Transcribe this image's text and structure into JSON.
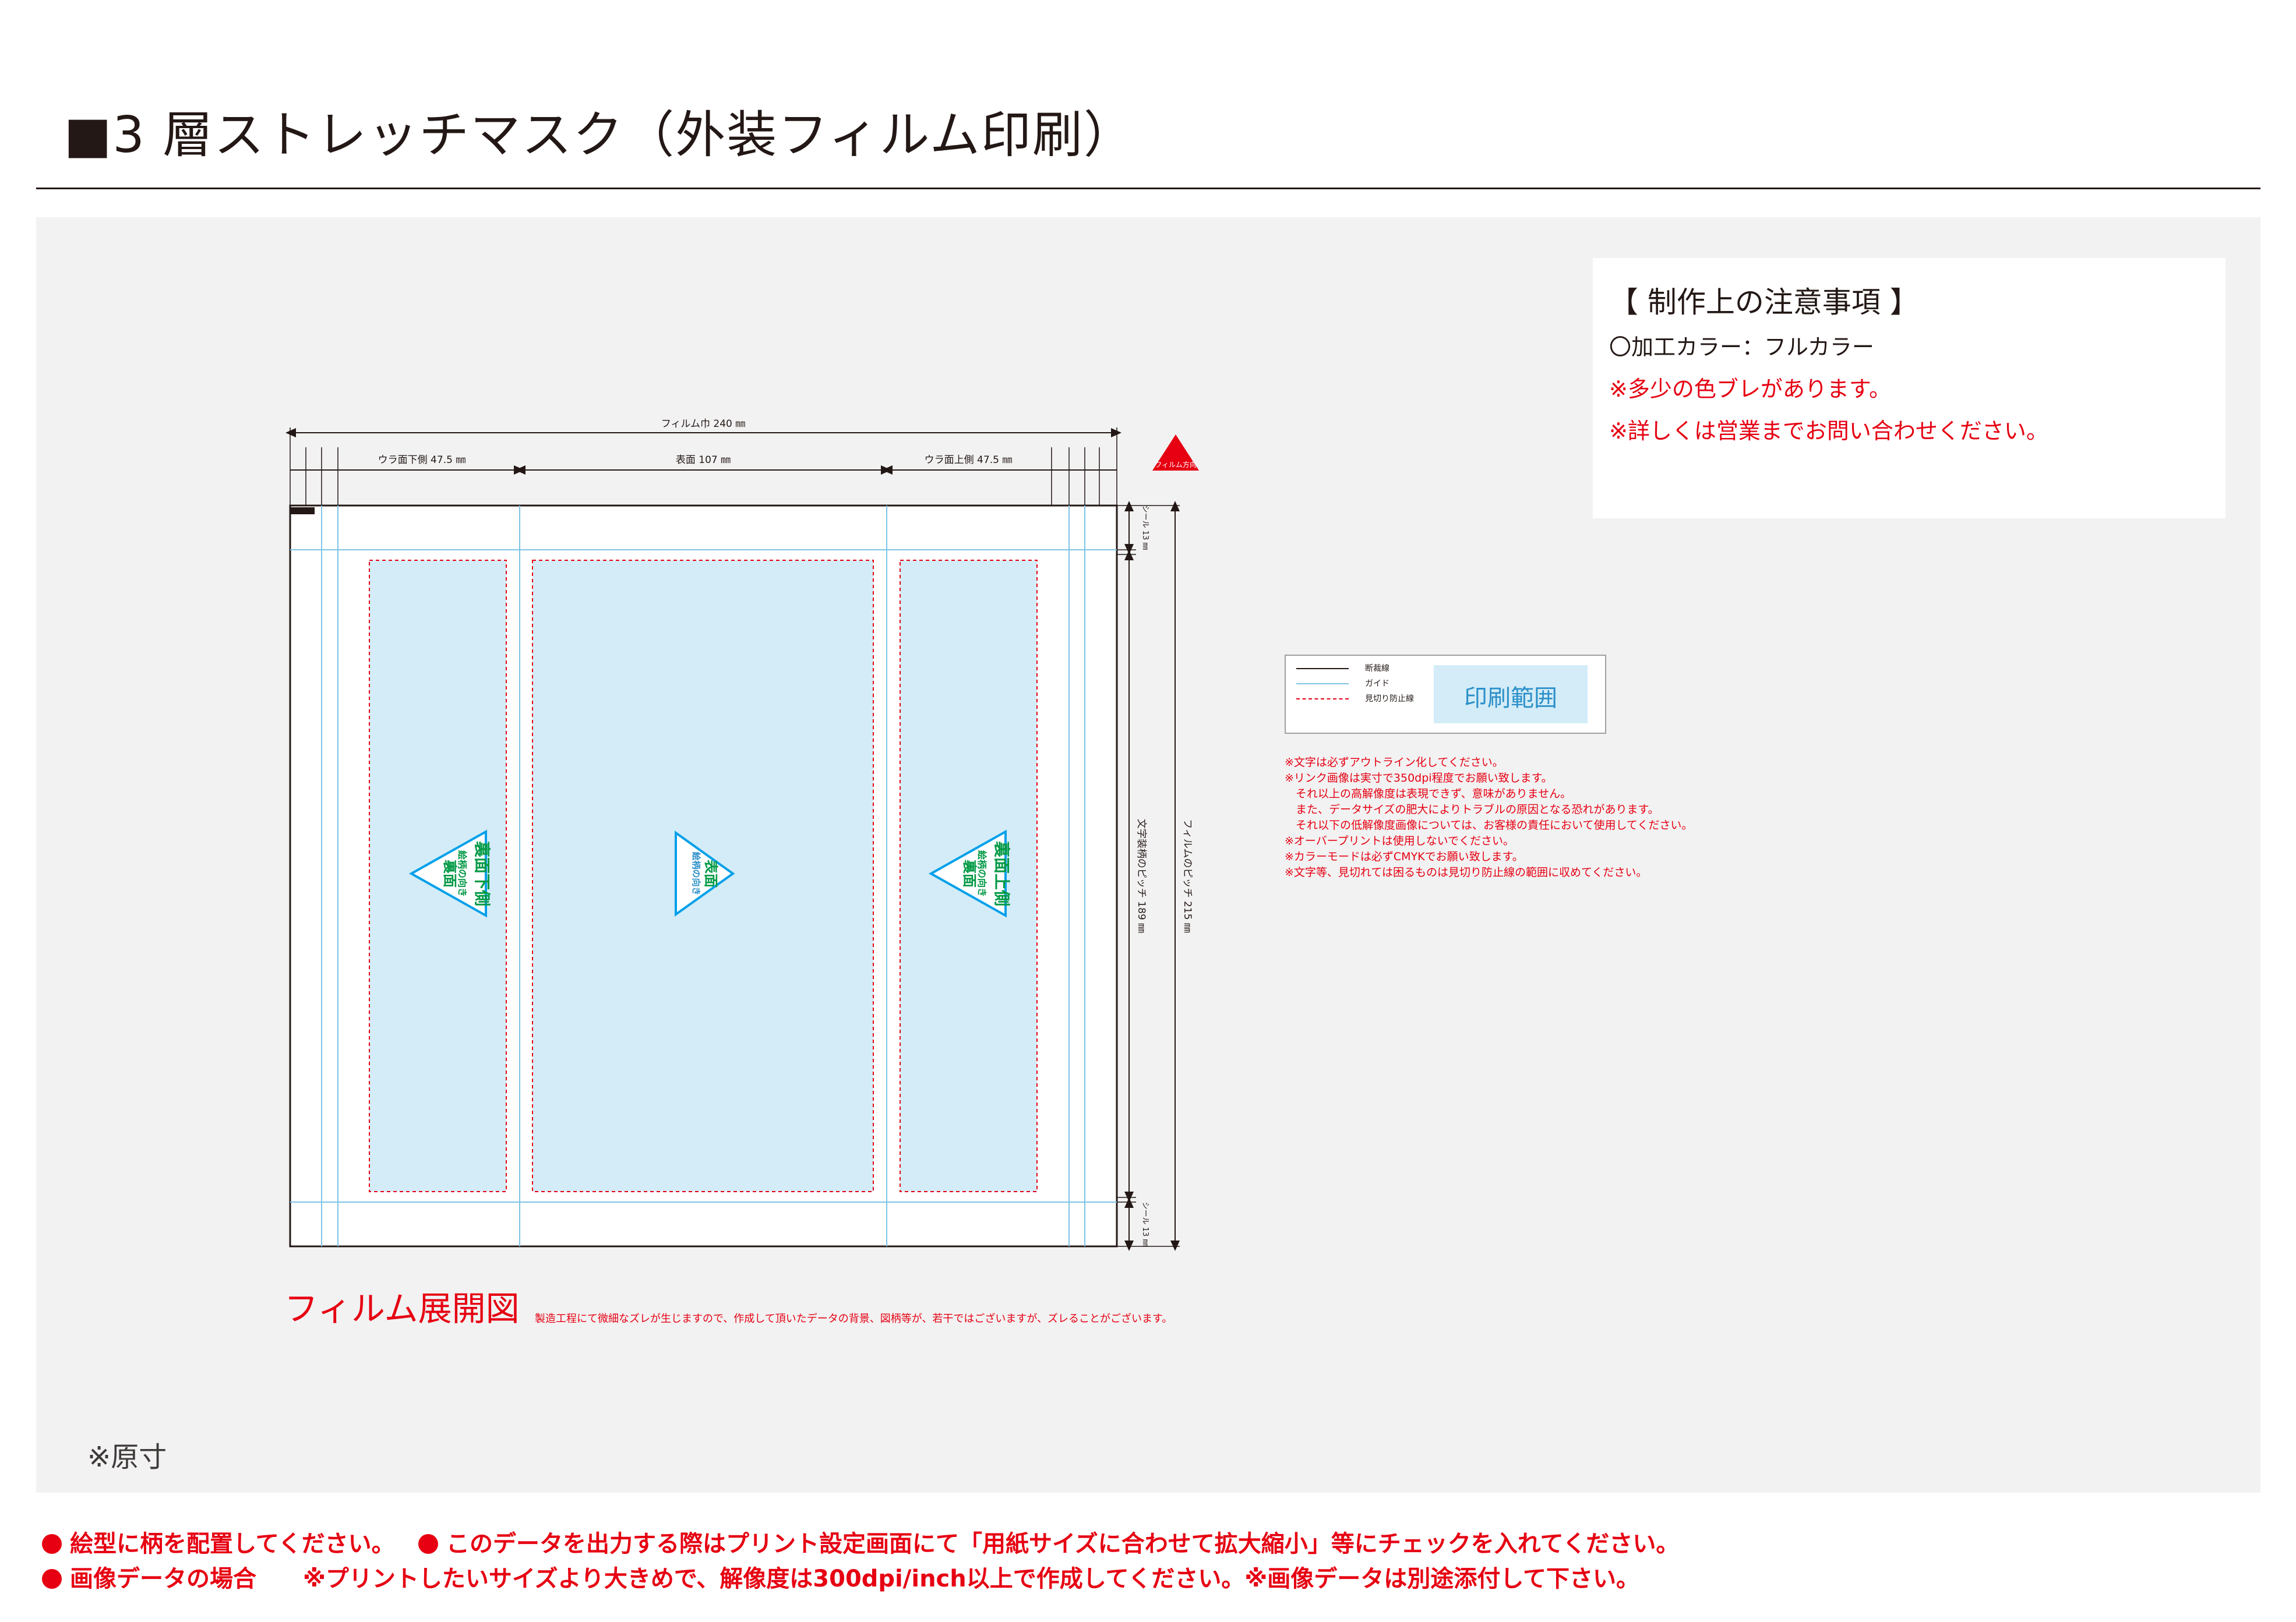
{
  "title": "■3 層ストレッチマスク（外装フィルム印刷）",
  "notes": {
    "heading": "【 制作上の注意事項 】",
    "process_color": "〇加工カラー：フルカラー",
    "color_blur": "※多少の色ブレがあります。",
    "contact_sales": "※詳しくは営業までお問い合わせください。"
  },
  "legend": {
    "cut_line": "断裁線",
    "guide": "ガイド",
    "see_through_line": "見切り防止線",
    "print_area": "印刷範囲"
  },
  "warnings": [
    "※文字は必ずアウトライン化してください。",
    "※リンク画像は実寸で350dpi程度でお願い致します。",
    "　それ以上の高解像度は表現できず、意味がありません。",
    "　また、データサイズの肥大によりトラブルの原因となる恐れがあります。",
    "　それ以下の低解像度画像については、お客様の責任において使用してください。",
    "※オーバープリントは使用しないでください。",
    "※カラーモードは必ずCMYKでお願い致します。",
    "※文字等、見切れては困るものは見切り防止線の範囲に収めてください。"
  ],
  "diagram": {
    "film_width": "フィルム巾 240 ㎜",
    "back_bottom": "ウラ面下側 47.5 ㎜",
    "front": "表面 107 ㎜",
    "back_top": "ウラ面上側 47.5 ㎜",
    "film_direction": "フィルム方向",
    "seal_top": "シール 13 ㎜",
    "seal_bottom": "シール 13 ㎜",
    "pattern_pitch": "文字装柄のピッチ 189 ㎜",
    "film_pitch": "フィルムのピッチ 215 ㎜",
    "tri_left_1": "裏面",
    "tri_left_2": "絵柄の向き",
    "tri_left_3": "裏面下側",
    "tri_center_1": "表面",
    "tri_center_2": "絵柄の向き",
    "tri_right_1": "裏面",
    "tri_right_2": "絵柄の向き",
    "tri_right_3": "裏面上側"
  },
  "diagram_title": "フィルム展開図",
  "diagram_note": "製造工程にて微細なズレが生じますので、作成して頂いたデータの背景、図柄等が、若干ではございますが、ズレることがございます。",
  "actual_size": "※原寸",
  "footer": {
    "line1a": "絵型に柄を配置してください。",
    "line1b": "このデータを出力する際はプリント設定画面にて「用紙サイズに合わせて拡大縮小」等にチェックを入れてください。",
    "line2": "画像データの場合　　※プリントしたいサイズより大きめで、解像度は300dpi/inch以上で作成してください。※画像データは別途添付して下さい。"
  },
  "colors": {
    "red": "#e60012",
    "print_area": "#d3ecf8",
    "guide": "#7ec4e6",
    "triangle": "#00a0e9",
    "triangle_text": "#009944"
  }
}
